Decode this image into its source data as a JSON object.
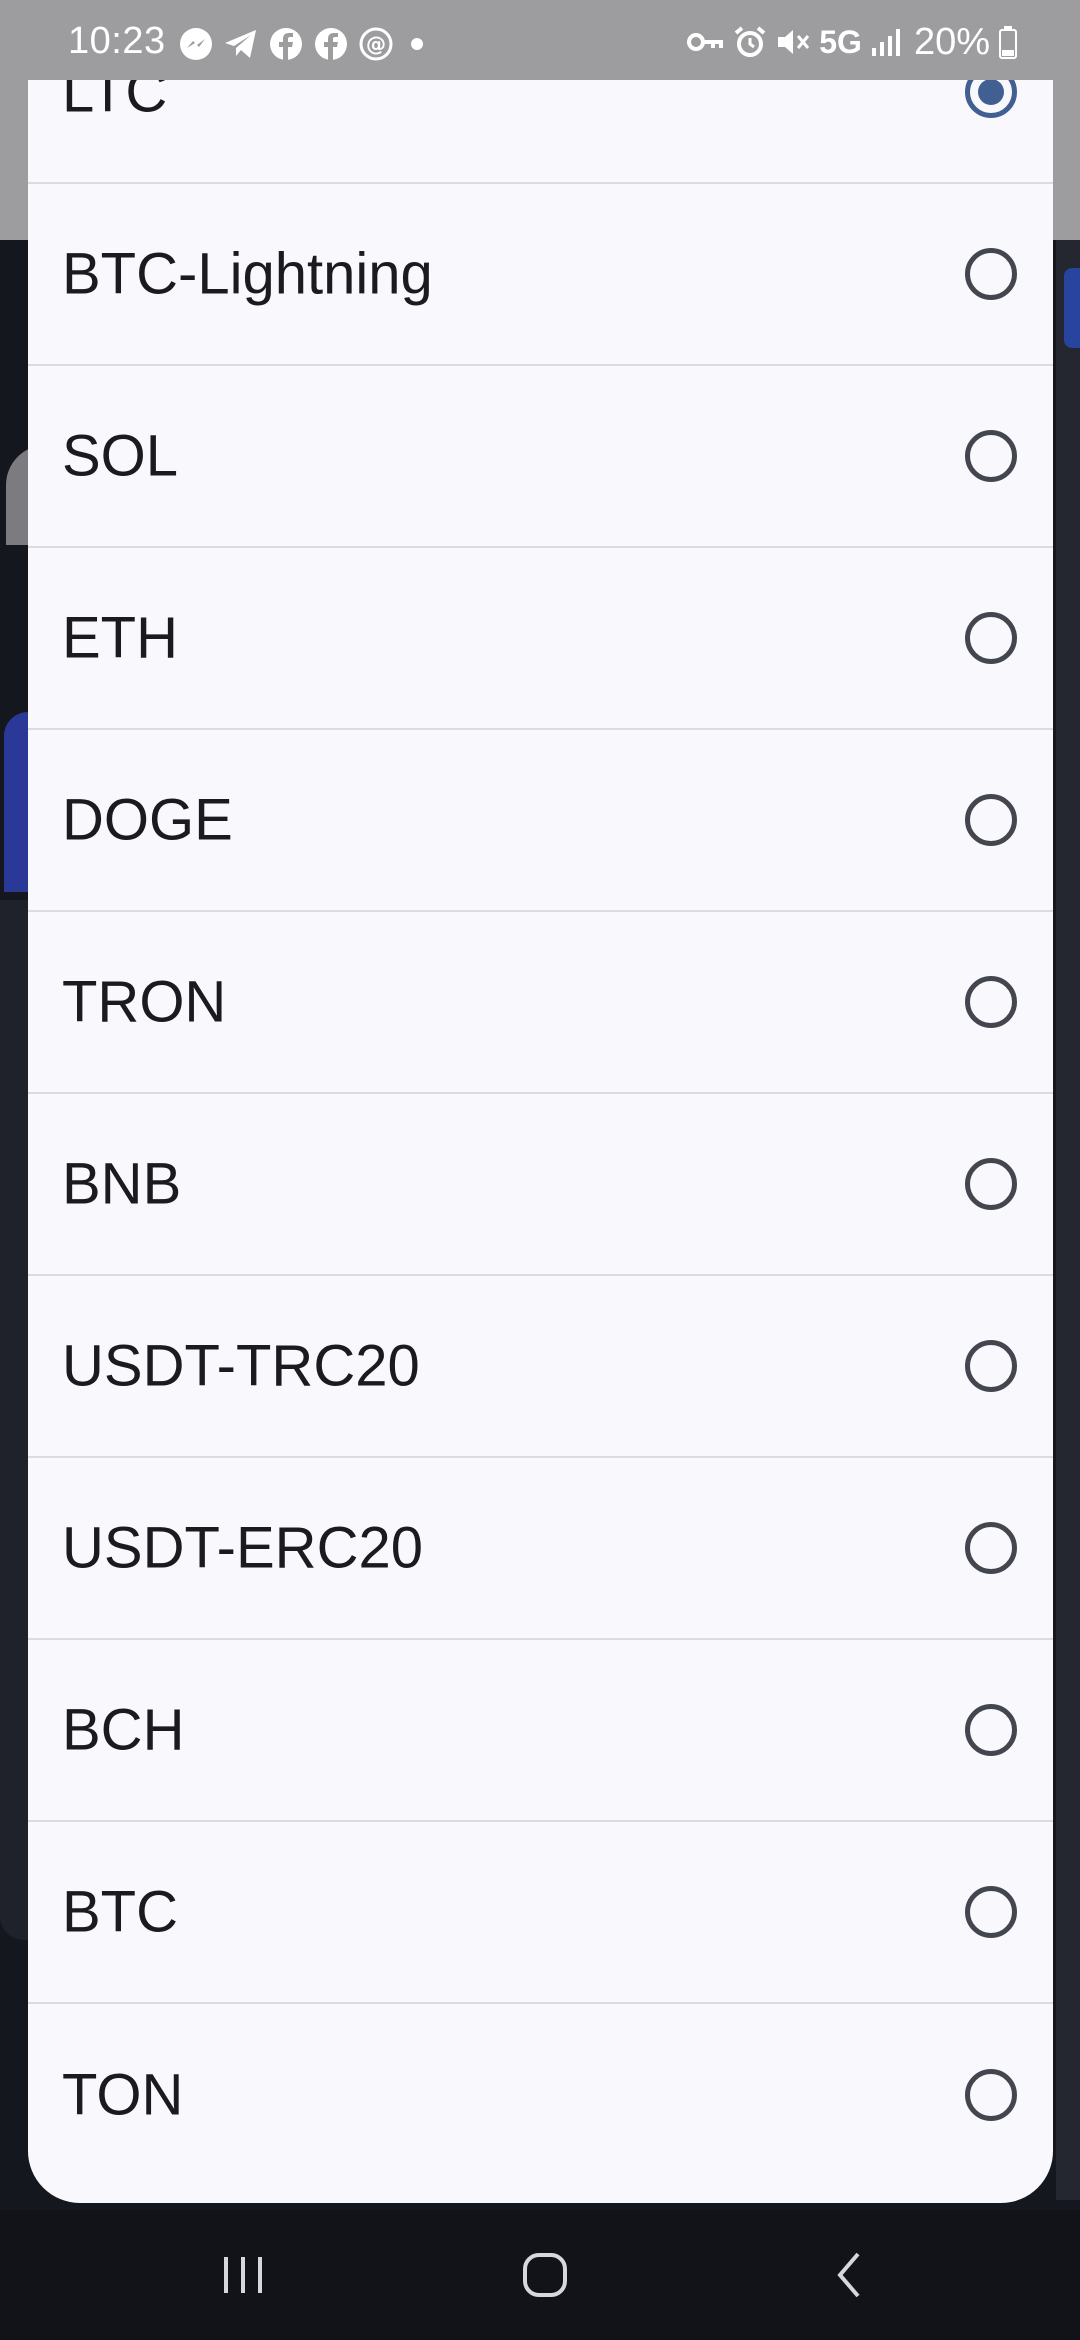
{
  "status_bar": {
    "time": "10:23",
    "network": "5G",
    "battery": "20%",
    "notification_icons": [
      "messenger-icon",
      "telegram-icon",
      "facebook-icon",
      "facebook-icon",
      "threads-icon",
      "more-dot-icon"
    ],
    "system_icons": [
      "vpn-key-icon",
      "alarm-icon",
      "mute-icon",
      "signal-icon",
      "battery-icon"
    ]
  },
  "dialog": {
    "options": [
      {
        "label": "LTC",
        "selected": true
      },
      {
        "label": "BTC-Lightning",
        "selected": false
      },
      {
        "label": "SOL",
        "selected": false
      },
      {
        "label": "ETH",
        "selected": false
      },
      {
        "label": "DOGE",
        "selected": false
      },
      {
        "label": "TRON",
        "selected": false
      },
      {
        "label": "BNB",
        "selected": false
      },
      {
        "label": "USDT-TRC20",
        "selected": false
      },
      {
        "label": "USDT-ERC20",
        "selected": false
      },
      {
        "label": "BCH",
        "selected": false
      },
      {
        "label": "BTC",
        "selected": false
      },
      {
        "label": "TON",
        "selected": false
      }
    ]
  },
  "nav_bar": {
    "buttons": [
      "recent-apps-icon",
      "home-icon",
      "back-icon"
    ]
  },
  "colors": {
    "accent": "#415f91",
    "dialog_bg": "#f8f8fd",
    "scrim": "#9d9d9f"
  }
}
